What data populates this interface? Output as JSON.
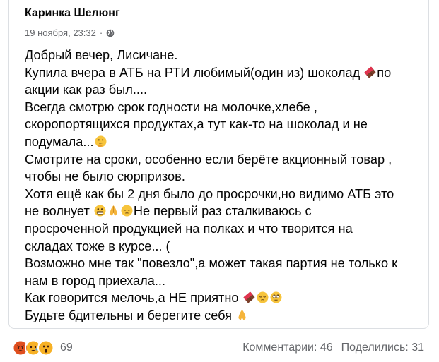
{
  "post": {
    "author": "Каринка Шелюнг",
    "date": "19 ноября, 23:32",
    "separator": "·",
    "privacy_icon": "globe-icon",
    "lines": [
      {
        "text": "Добрый вечер, Лисичане."
      },
      {
        "text": "Купила вчера  в АТБ на РТИ любимый(один из) шоколад ",
        "emoji": [
          "chocolate-emoji"
        ],
        "after": "по"
      },
      {
        "text": "акции как раз был...."
      },
      {
        "text": "Всегда смотрю срок годности на молочке,хлебе ,"
      },
      {
        "text": " скоропортящихся продуктах,а тут как-то на шоколад и не"
      },
      {
        "text": "подумала...",
        "emoji": [
          "thinking-face-emoji"
        ]
      },
      {
        "text": "Смотрите на сроки, особенно если берёте акционный товар ,"
      },
      {
        "text": " чтобы не было  сюрпризов."
      },
      {
        "text": "Хотя ещё как бы 2 дня было до просрочки,но видимо АТБ это"
      },
      {
        "text": "не волнует ",
        "emoji": [
          "grimacing-face-emoji",
          "folded-hands-emoji",
          "pensive-face-emoji"
        ],
        "after": "Не первый раз сталкиваюсь с"
      },
      {
        "text": "просроченной продукцией на полках и что творится на"
      },
      {
        "text": "складах тоже в курсе... ("
      },
      {
        "text": "Возможно мне так \"повезло\",а может такая партия не только к"
      },
      {
        "text": "нам в город приехала..."
      },
      {
        "text": "Как говорится мелочь,а НЕ приятно ",
        "emoji": [
          "chocolate-emoji",
          "pensive-face-emoji",
          "rolling-eyes-emoji"
        ]
      },
      {
        "text": "Будьте бдительны и берегите себя ",
        "emoji": [
          "folded-hands-emoji"
        ]
      }
    ]
  },
  "footer": {
    "reactions": [
      "angry-reaction",
      "sad-reaction",
      "wow-reaction"
    ],
    "reaction_count": "69",
    "comments": "Комментарии: 46",
    "shares": "Поделились: 31"
  },
  "colors": {
    "text": "#050505",
    "secondary": "#65676b",
    "border": "#dcdfe3"
  }
}
